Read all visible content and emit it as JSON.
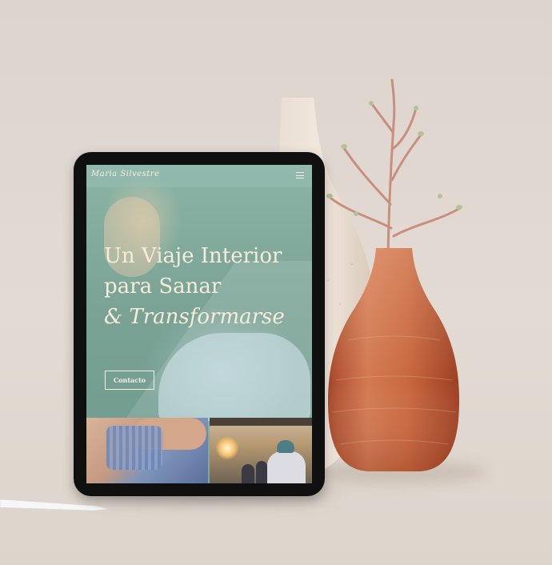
{
  "site": {
    "logo_text": "Maria Silvestre",
    "menu_icon": "hamburger-icon"
  },
  "hero": {
    "headline_line1": "Un Viaje Interior",
    "headline_line2": "para Sanar",
    "headline_line3": "& Transformarse",
    "cta_label": "Contacto"
  },
  "colors": {
    "overlay": "#7fa79a",
    "headline": "#f6ecdc",
    "background": "#e2dad2",
    "vase": "#c9683f"
  }
}
